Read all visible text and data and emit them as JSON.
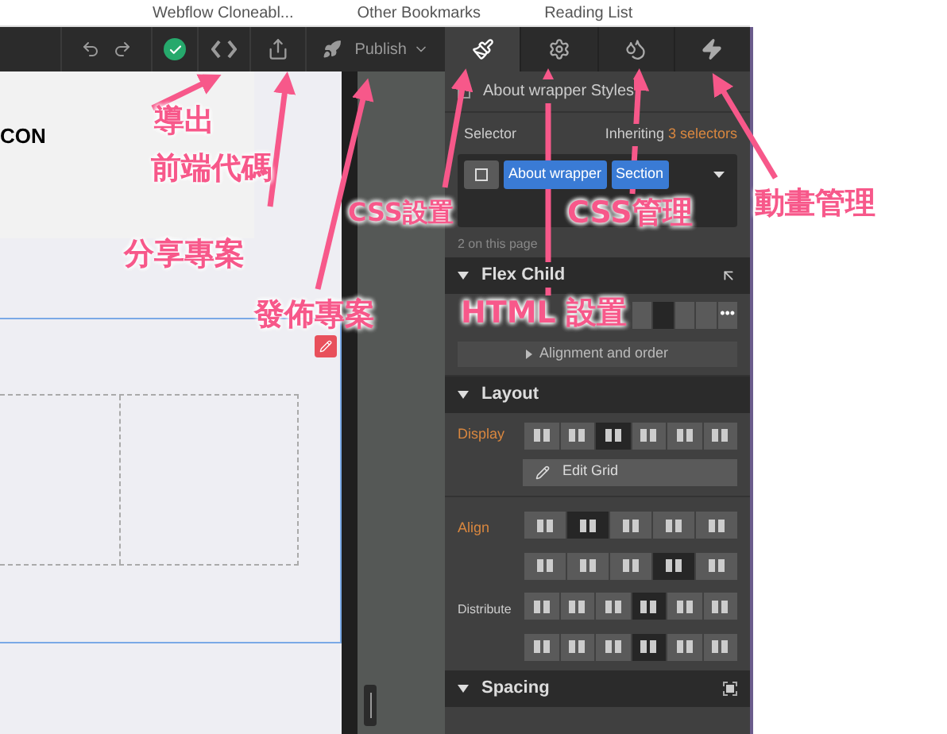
{
  "browser_bar": {
    "bookmarks": [
      "Webflow Cloneabl...",
      "Other Bookmarks",
      "Reading List"
    ]
  },
  "toolbar": {
    "publish": "Publish"
  },
  "panel_tabs": [
    {
      "kind": "brush",
      "selected": true
    },
    {
      "kind": "gear",
      "selected": false
    },
    {
      "kind": "drops",
      "selected": false
    },
    {
      "kind": "bolt",
      "selected": false
    }
  ],
  "canvas": {
    "heading_fragment": "CON"
  },
  "style_panel": {
    "title": "About wrapper Styles",
    "selector_label": "Selector",
    "inheriting": "Inheriting",
    "inheriting_count": "3 selectors",
    "tags": [
      "About wrapper",
      "Section"
    ],
    "count_note": "2 on this page",
    "flex_child": {
      "heading": "Flex Child",
      "options": [
        {
          "selected": false
        },
        {
          "selected": true
        },
        {
          "selected": false
        },
        {
          "selected": false
        }
      ],
      "more": "•••",
      "alignment": "Alignment and order"
    },
    "layout": {
      "heading": "Layout",
      "display_label": "Display",
      "display_options": [
        {
          "selected": false
        },
        {
          "selected": false
        },
        {
          "selected": true
        },
        {
          "selected": false
        },
        {
          "selected": false
        },
        {
          "selected": false
        }
      ],
      "edit_grid": "Edit Grid",
      "align_label": "Align",
      "align_rows": [
        [
          {
            "selected": false
          },
          {
            "selected": true
          },
          {
            "selected": false
          },
          {
            "selected": false
          },
          {
            "selected": false
          }
        ],
        [
          {
            "selected": false
          },
          {
            "selected": false
          },
          {
            "selected": false
          },
          {
            "selected": true
          },
          {
            "selected": false
          }
        ]
      ],
      "distribute_label": "Distribute",
      "distribute_rows": [
        [
          {
            "selected": false
          },
          {
            "selected": false
          },
          {
            "selected": false
          },
          {
            "selected": true
          },
          {
            "selected": false
          },
          {
            "selected": false
          }
        ],
        [
          {
            "selected": false
          },
          {
            "selected": false
          },
          {
            "selected": false
          },
          {
            "selected": true
          },
          {
            "selected": false
          },
          {
            "selected": false
          }
        ]
      ]
    },
    "spacing": {
      "heading": "Spacing"
    }
  },
  "annotations": [
    "導出",
    "前端代碼",
    "分享專案",
    "發佈專案",
    "CSS設置",
    "HTML 設置",
    "CSS管理",
    "動畫管理"
  ]
}
